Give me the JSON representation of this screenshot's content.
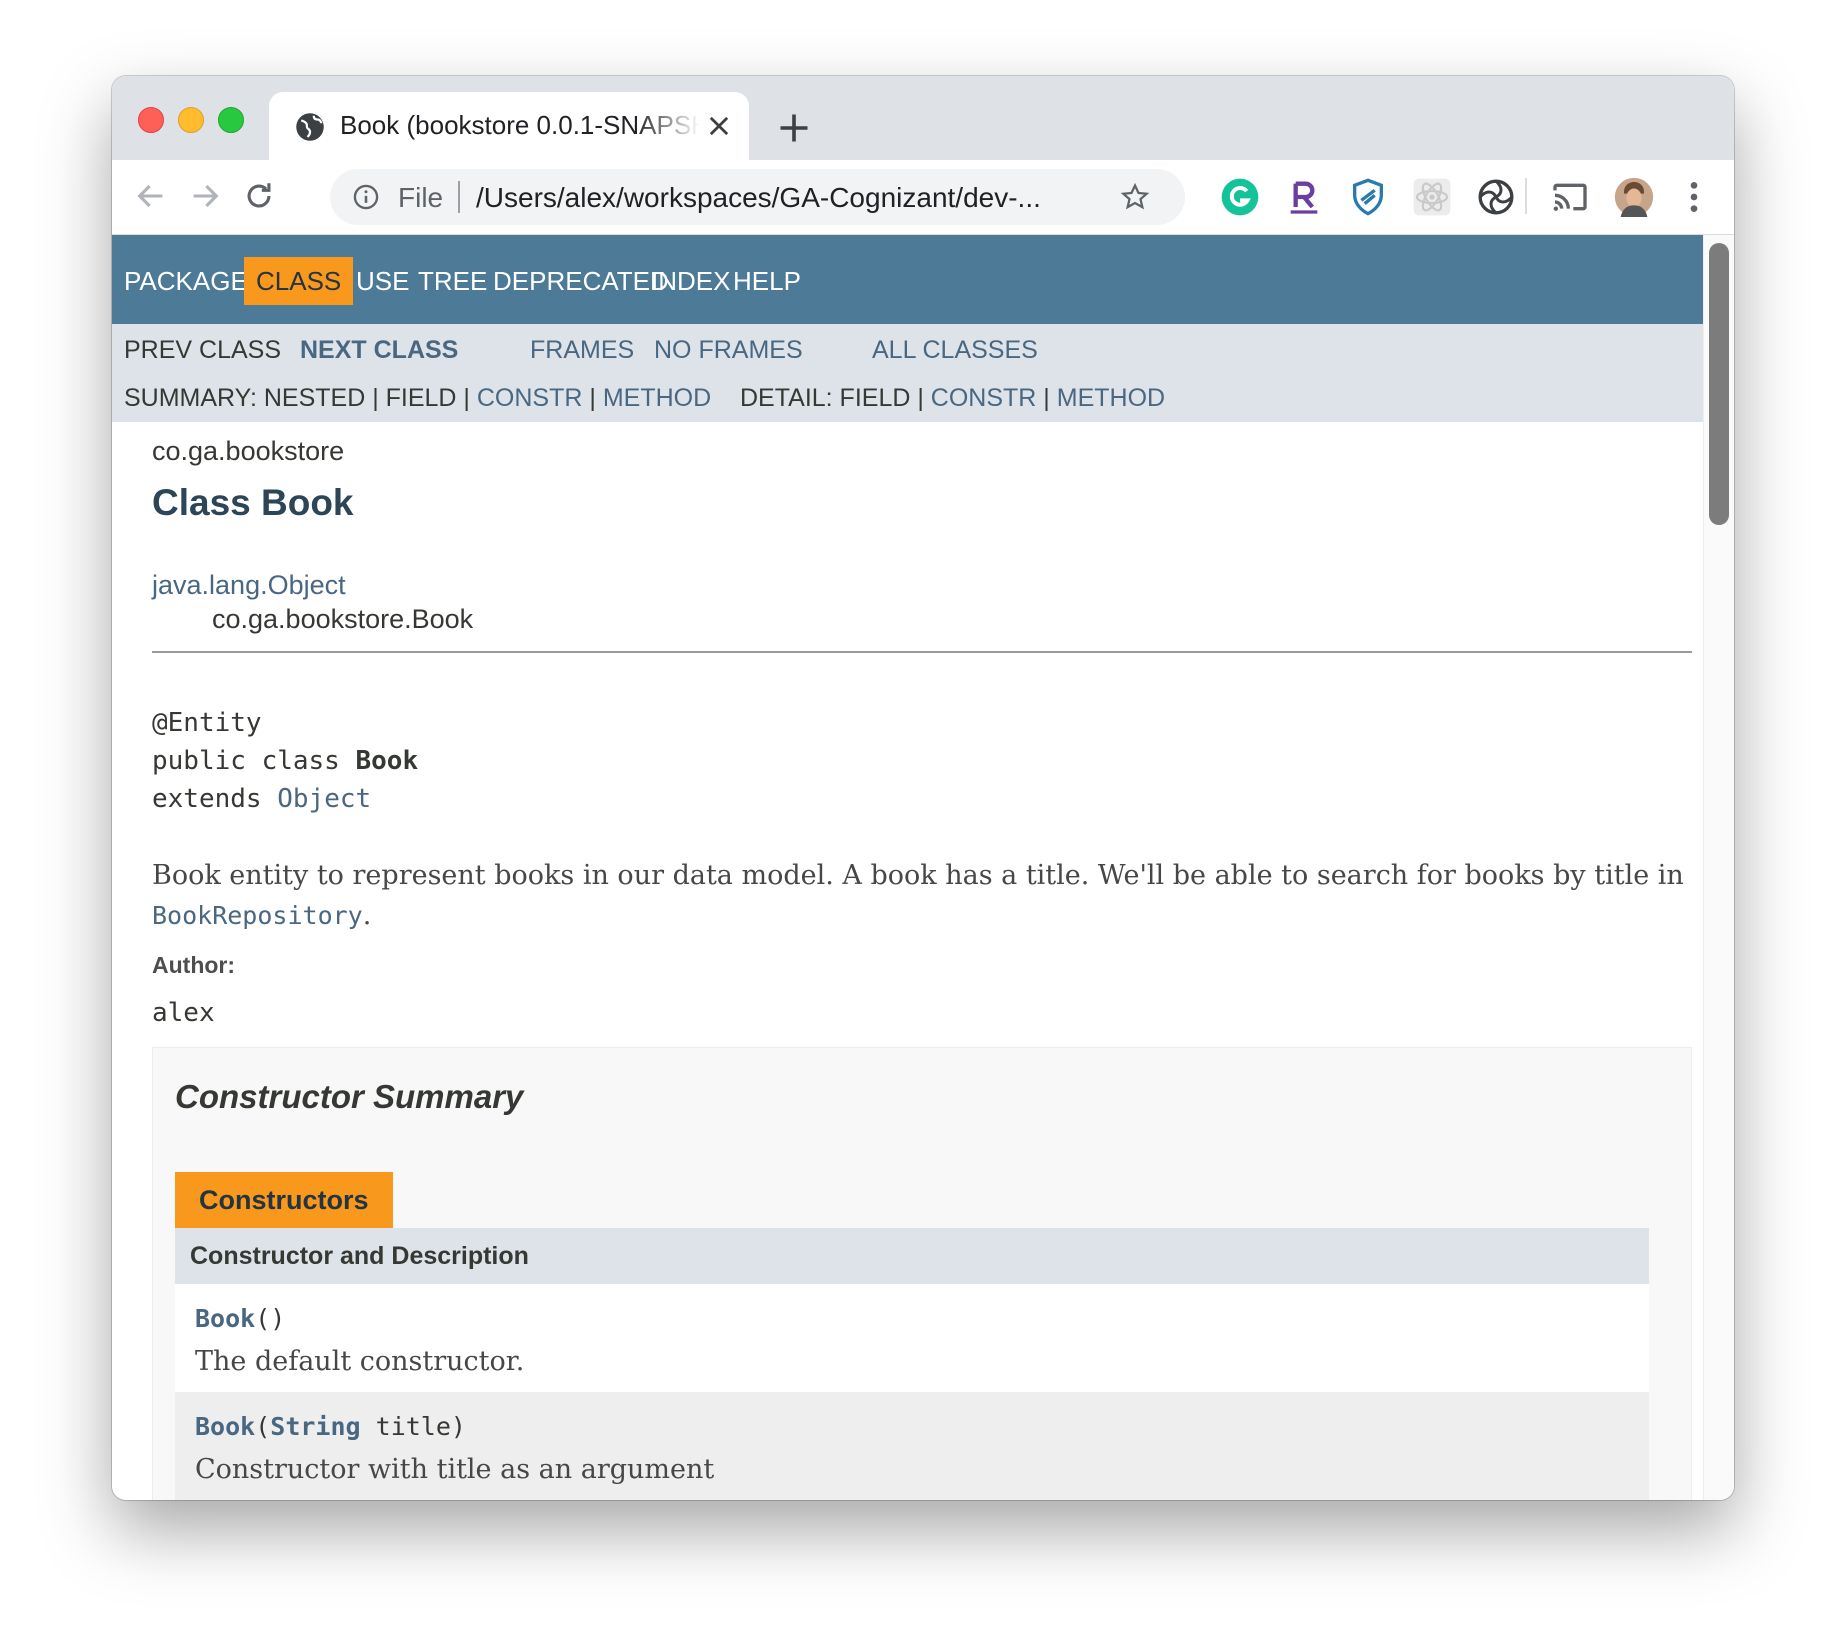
{
  "browser": {
    "tab_title": "Book (bookstore 0.0.1-SNAPSHOT API)",
    "omnibox_scheme": "File",
    "url": "/Users/alex/workspaces/GA-Cognizant/dev-..."
  },
  "topnav": [
    "PACKAGE",
    "CLASS",
    "USE",
    "TREE",
    "DEPRECATED",
    "INDEX",
    "HELP"
  ],
  "subnav": {
    "prev_class": "PREV CLASS",
    "next_class": "NEXT CLASS",
    "frames": "FRAMES",
    "no_frames": "NO FRAMES",
    "all_classes": "ALL CLASSES",
    "summary_label": "SUMMARY: NESTED | FIELD | ",
    "summary_constr": "CONSTR",
    "summary_sep": " | ",
    "summary_method": "METHOD",
    "detail_label": "DETAIL: FIELD | ",
    "detail_constr": "CONSTR",
    "detail_sep": " | ",
    "detail_method": "METHOD"
  },
  "class_info": {
    "package": "co.ga.bookstore",
    "title": "Class Book",
    "inherit_parent": "java.lang.Object",
    "inherit_child": "co.ga.bookstore.Book",
    "annotation": "@Entity",
    "decl_prefix": "public class ",
    "decl_name": "Book",
    "extends_prefix": "extends ",
    "extends_name": "Object",
    "description": "Book entity to represent books in our data model. A book has a title. We'll be able to search for books by title in",
    "description_link": "BookRepository",
    "description_end": ".",
    "author_label": "Author:",
    "author": "alex"
  },
  "constructor_summary": {
    "title": "Constructor Summary",
    "caption": "Constructors",
    "header": "Constructor and Description",
    "rows": [
      {
        "name": "Book",
        "args_open": "(",
        "arg_type": "",
        "arg_rest": ")",
        "description": "The default constructor."
      },
      {
        "name": "Book",
        "args_open": "(",
        "arg_type": "String",
        "arg_rest": " title)",
        "description": "Constructor with title as an argument"
      }
    ]
  },
  "colors": {
    "nav_bg": "#4d7a97",
    "active_tab": "#f8981d",
    "subnav_bg": "#dee3e9",
    "link": "#4a6782"
  }
}
